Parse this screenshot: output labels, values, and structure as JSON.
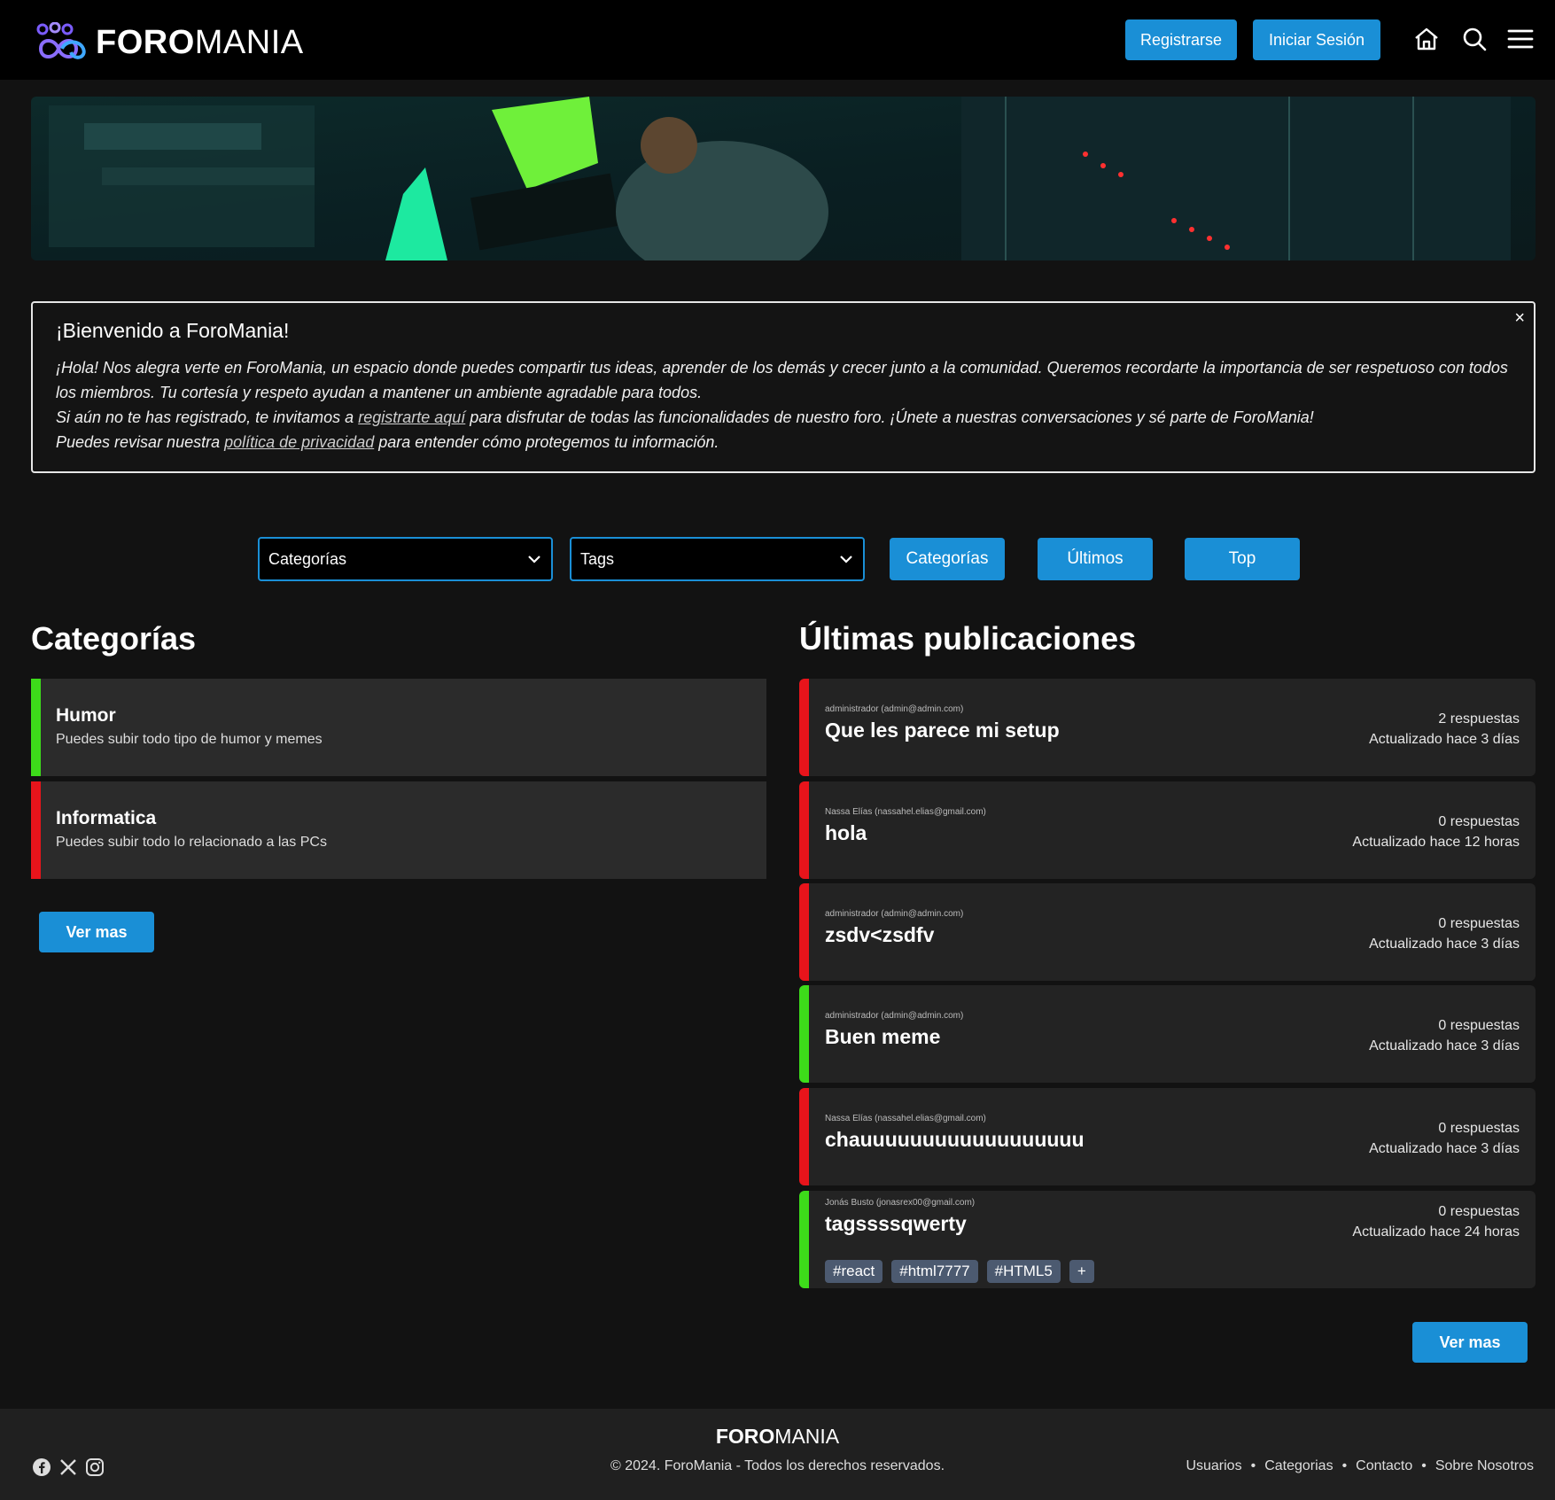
{
  "header": {
    "logo_bold": "FORO",
    "logo_light": "MANIA",
    "register_label": "Registrarse",
    "login_label": "Iniciar Sesión"
  },
  "welcome": {
    "title": "¡Bienvenido a ForoMania!",
    "close": "×",
    "p1": "¡Hola! Nos alegra verte en ForoMania, un espacio donde puedes compartir tus ideas, aprender de los demás y crecer junto a la comunidad. Queremos recordarte la importancia de ser respetuoso con todos los miembros. Tu cortesía y respeto ayudan a mantener un ambiente agradable para todos.",
    "p2_pre": "Si aún no te has registrado, te invitamos a ",
    "p2_link": "registrarte aquí",
    "p2_post": " para disfrutar de todas las funcionalidades de nuestro foro. ¡Únete a nuestras conversaciones y sé parte de ForoMania!",
    "p3_pre": "Puedes revisar nuestra ",
    "p3_link": "política de privacidad",
    "p3_post": " para entender cómo protegemos tu información."
  },
  "filters": {
    "categories_select": "Categorías",
    "tags_select": "Tags",
    "btn_categories": "Categorías",
    "btn_latest": "Últimos",
    "btn_top": "Top"
  },
  "categories": {
    "title": "Categorías",
    "items": [
      {
        "name": "Humor",
        "desc": "Puedes subir todo tipo de humor y memes",
        "color": "#3ddc1a"
      },
      {
        "name": "Informatica",
        "desc": "Puedes subir todo lo relacionado a las PCs",
        "color": "#e8141b"
      }
    ],
    "more_label": "Ver mas"
  },
  "posts": {
    "title": "Últimas publicaciones",
    "items": [
      {
        "author": "administrador (admin@admin.com)",
        "title": "Que les parece mi setup",
        "replies": "2 respuestas",
        "updated": "Actualizado hace 3 días",
        "color": "#e8141b"
      },
      {
        "author": "Nassa Elías (nassahel.elias@gmail.com)",
        "title": "hola",
        "replies": "0 respuestas",
        "updated": "Actualizado hace 12 horas",
        "color": "#e8141b"
      },
      {
        "author": "administrador (admin@admin.com)",
        "title": "zsdv<zsdfv",
        "replies": "0 respuestas",
        "updated": "Actualizado hace 3 días",
        "color": "#e8141b"
      },
      {
        "author": "administrador (admin@admin.com)",
        "title": "Buen meme",
        "replies": "0 respuestas",
        "updated": "Actualizado hace 3 días",
        "color": "#3ddc1a"
      },
      {
        "author": "Nassa Elías (nassahel.elias@gmail.com)",
        "title": "chauuuuuuuuuuuuuuuuuu",
        "replies": "0 respuestas",
        "updated": "Actualizado hace 3 días",
        "color": "#e8141b"
      },
      {
        "author": "Jonás Busto (jonasrex00@gmail.com)",
        "title": "tagssssqwerty",
        "replies": "0 respuestas",
        "updated": "Actualizado hace 24 horas",
        "color": "#3ddc1a",
        "tags": [
          "#react",
          "#html7777",
          "#HTML5",
          "+"
        ]
      }
    ],
    "more_label": "Ver mas"
  },
  "footer": {
    "logo_bold": "FORO",
    "logo_light": "MANIA",
    "copyright": "© 2024. ForoMania - Todos los derechos reservados.",
    "links": [
      "Usuarios",
      "Categorias",
      "Contacto",
      "Sobre Nosotros"
    ],
    "separator": "•"
  },
  "colors": {
    "accent": "#1a8fd6",
    "green": "#3ddc1a",
    "red": "#e8141b"
  }
}
